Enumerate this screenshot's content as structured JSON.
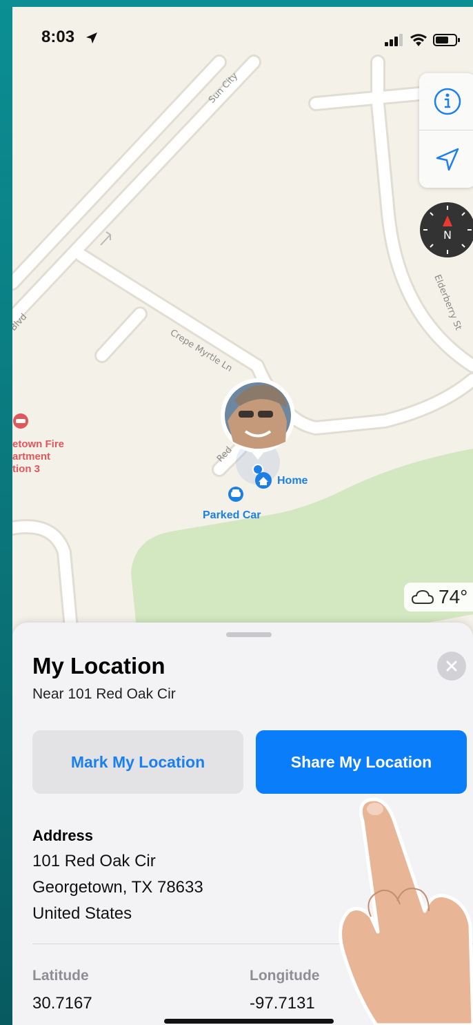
{
  "status_bar": {
    "time": "8:03"
  },
  "map": {
    "streets": [
      "Sun City",
      "Blvd",
      "Crepe Myrtle Ln",
      "Elderberry St",
      "Red"
    ],
    "poi": [
      {
        "name": "etown Fire\nartment\ntion 3",
        "icon": "fire-station-icon",
        "color": "#e0565b"
      },
      {
        "name": "Home",
        "icon": "home-icon",
        "color": "#1c7fe4"
      },
      {
        "name": "Parked Car",
        "icon": "car-icon",
        "color": "#1c7fe4"
      }
    ],
    "weather": {
      "icon": "cloud-icon",
      "temperature": "74°"
    },
    "compass_letter": "N"
  },
  "sheet": {
    "title": "My Location",
    "subtitle": "Near 101 Red Oak Cir",
    "mark_button": "Mark My Location",
    "share_button": "Share My Location",
    "address_heading": "Address",
    "address_lines": [
      "101 Red Oak Cir",
      "Georgetown, TX  78633",
      "United States"
    ],
    "latitude_label": "Latitude",
    "latitude": "30.7167",
    "longitude_label": "Longitude",
    "longitude": "-97.7131"
  },
  "colors": {
    "accent": "#0a7dfb",
    "map_background": "#f4f1e8",
    "park_green": "#d3e7c0",
    "poi_red": "#e0565b",
    "background_teal": "#0b8f93"
  }
}
